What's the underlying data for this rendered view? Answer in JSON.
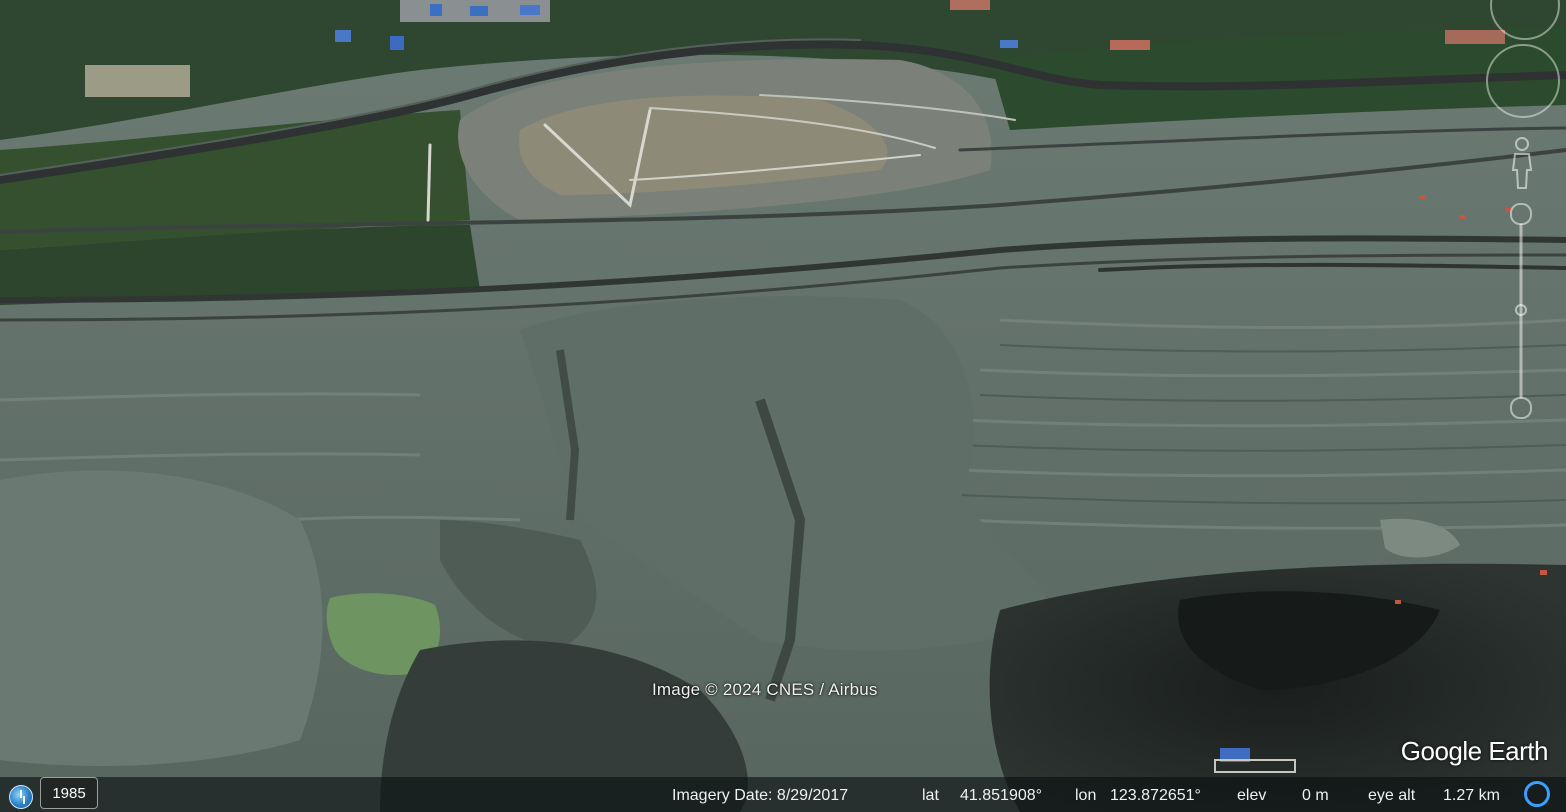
{
  "map": {
    "copyright": "Image © 2024 CNES / Airbus",
    "brand": "Google Earth"
  },
  "historical": {
    "icon": "historical-imagery-clock-icon",
    "year": "1985"
  },
  "status": {
    "imagery_date_label": "Imagery Date: 8/29/2017",
    "lat_label": "lat",
    "lat_value": "41.851908°",
    "lon_label": "lon",
    "lon_value": "123.872651°",
    "elev_label": "elev",
    "elev_value": "0 m",
    "eye_alt_label": "eye alt",
    "eye_alt_value": "1.27 km",
    "loading_icon": "streaming-progress-icon"
  },
  "colors": {
    "status_accent": "#3aa0ff",
    "terrain_gray": "#6b7a72",
    "forest_green": "#2f4a2e",
    "coal_black": "#1f2422",
    "pond_green": "#6f9462"
  }
}
